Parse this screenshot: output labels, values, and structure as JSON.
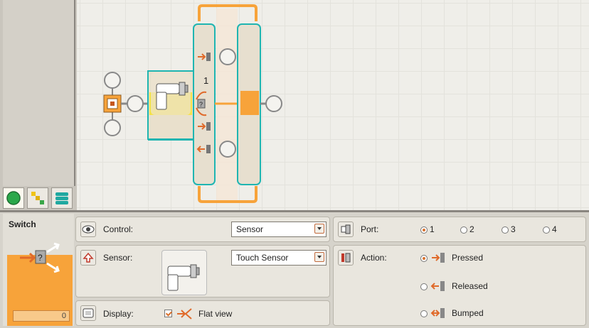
{
  "palette": {
    "tabs": [
      {
        "name": "common-palette-tab",
        "icon": "green-circle-icon"
      },
      {
        "name": "complete-palette-tab",
        "icon": "blocks-icon"
      },
      {
        "name": "custom-palette-tab",
        "icon": "custom-stack-icon"
      }
    ]
  },
  "canvas": {
    "switch_case_label": "1"
  },
  "panel": {
    "block_title": "Switch",
    "block_counter": "0",
    "control": {
      "label": "Control:",
      "value": "Sensor"
    },
    "sensor": {
      "label": "Sensor:",
      "value": "Touch Sensor"
    },
    "display": {
      "label": "Display:",
      "flat_view_label": "Flat view",
      "flat_view_checked": true
    },
    "port": {
      "label": "Port:",
      "options": [
        "1",
        "2",
        "3",
        "4"
      ],
      "selected": "1"
    },
    "action": {
      "label": "Action:",
      "options": [
        "Pressed",
        "Released",
        "Bumped"
      ],
      "selected": "Pressed"
    }
  },
  "colors": {
    "accent_orange": "#f7a33a",
    "selection_teal": "#1fb5b1",
    "touch_yellow": "#f5e24a"
  }
}
